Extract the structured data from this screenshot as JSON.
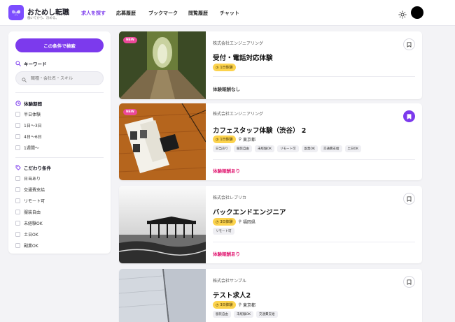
{
  "app": {
    "title": "おためし転職",
    "subtitle": "働いてから、決める。",
    "accent": "#7c3aed"
  },
  "nav": [
    {
      "label": "求人を探す",
      "active": true
    },
    {
      "label": "応募履歴",
      "active": false
    },
    {
      "label": "ブックマーク",
      "active": false
    },
    {
      "label": "閲覧履歴",
      "active": false
    },
    {
      "label": "チャット",
      "active": false
    }
  ],
  "header_icons": {
    "theme": "sun-icon",
    "avatar": "avatar"
  },
  "sidebar": {
    "search_button": "この条件で検索",
    "keyword": {
      "title": "キーワード",
      "placeholder": "職種・会社名・スキル"
    },
    "period": {
      "title": "体験期間",
      "options": [
        "半日体験",
        "1日〜3日",
        "4日〜6日",
        "1週間〜"
      ]
    },
    "conditions": {
      "title": "こだわり条件",
      "options": [
        "日当あり",
        "交通費支給",
        "リモート可",
        "服装自由",
        "未経験OK",
        "土日OK",
        "副業OK"
      ]
    }
  },
  "jobs": [
    {
      "new_badge": "NEW",
      "company": "株式会社エンジニアリング",
      "title": "受付・電話対応体験",
      "duration": "1日体験",
      "location": "",
      "tags": [],
      "reward": "体験報酬なし",
      "reward_color": "#444444",
      "bookmarked": false
    },
    {
      "new_badge": "NEW",
      "company": "株式会社エンジニアリング",
      "title": "カフェスタッフ体験（渋谷） 2",
      "duration": "1日体験",
      "location": "東京都",
      "tags": [
        "日当あり",
        "服装自由",
        "未経験OK",
        "リモート可",
        "副業OK",
        "交通費支給",
        "土日OK"
      ],
      "reward": "体験報酬あり",
      "reward_color": "#e11d74",
      "bookmarked": true
    },
    {
      "new_badge": "",
      "company": "株式会社レプリカ",
      "title": "バックエンドエンジニア",
      "duration": "3日体験",
      "location": "福岡県",
      "tags": [
        "リモート可"
      ],
      "reward": "体験報酬あり",
      "reward_color": "#e11d74",
      "bookmarked": false
    },
    {
      "new_badge": "",
      "company": "株式会社サンプル",
      "title": "テスト求人2",
      "duration": "3日体験",
      "location": "東京都",
      "tags": [
        "服装自由",
        "未経験OK",
        "交通費支給"
      ],
      "reward": "",
      "reward_color": "#e11d74",
      "bookmarked": false
    }
  ]
}
